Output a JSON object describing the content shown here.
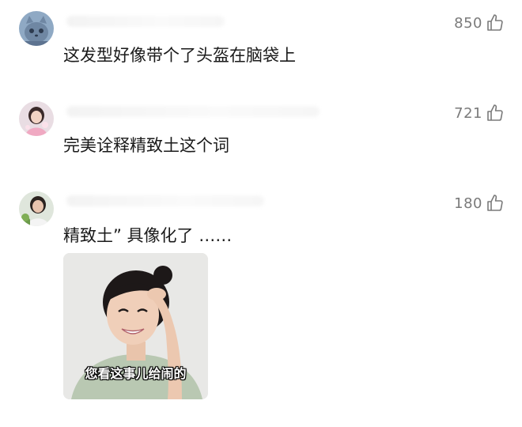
{
  "comments": [
    {
      "text": "这发型好像带个了头盔在脑袋上",
      "likes": "850",
      "avatar_icon": "cartoon-cat-avatar"
    },
    {
      "text": "完美诠释精致土这个词",
      "likes": "721",
      "avatar_icon": "girl-photo-avatar"
    },
    {
      "text": "精致土” 具像化了 ……",
      "likes": "180",
      "avatar_icon": "woman-photo-avatar",
      "image": {
        "caption": "您看这事儿给闹的"
      }
    }
  ],
  "like_icon": "thumbs-up-icon",
  "colors": {
    "text": "#1a1a1a",
    "like_count": "#7a7a7a",
    "background": "#ffffff"
  }
}
